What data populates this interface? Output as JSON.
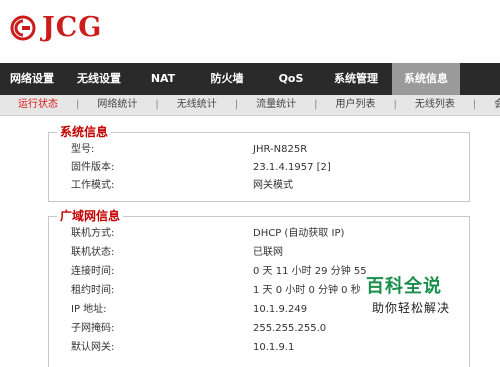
{
  "header": {
    "logo_text": "JCG"
  },
  "nav": {
    "items": [
      {
        "label": "网络设置"
      },
      {
        "label": "无线设置"
      },
      {
        "label": "NAT"
      },
      {
        "label": "防火墙"
      },
      {
        "label": "QoS"
      },
      {
        "label": "系统管理"
      },
      {
        "label": "系统信息"
      }
    ]
  },
  "subnav": {
    "items": [
      {
        "label": "运行状态"
      },
      {
        "label": "网络统计"
      },
      {
        "label": "无线统计"
      },
      {
        "label": "流量统计"
      },
      {
        "label": "用户列表"
      },
      {
        "label": "无线列表"
      },
      {
        "label": "会话"
      }
    ],
    "separator": "|"
  },
  "system_info": {
    "title": "系统信息",
    "rows": [
      {
        "label": "型号:",
        "value": "JHR-N825R"
      },
      {
        "label": "固件版本:",
        "value": "23.1.4.1957 [2]"
      },
      {
        "label": "工作模式:",
        "value": "网关模式"
      }
    ]
  },
  "wan_info": {
    "title": "广域网信息",
    "rows": [
      {
        "label": "联机方式:",
        "value": "DHCP (自动获取 IP)"
      },
      {
        "label": "联机状态:",
        "value": "已联网"
      },
      {
        "label": "连接时间:",
        "value": "0 天 11 小时 29 分钟 55"
      },
      {
        "label": "租约时间:",
        "value": "1 天 0 小时 0 分钟 0 秒"
      },
      {
        "label": "IP 地址:",
        "value": "10.1.9.249"
      },
      {
        "label": "子网掩码:",
        "value": "255.255.255.0"
      },
      {
        "label": "默认网关:",
        "value": "10.1.9.1"
      }
    ]
  },
  "watermark": {
    "title": "百科全说",
    "subtitle": "助你轻松解决"
  },
  "colors": {
    "brand_red": "#cc1d1d",
    "nav_bg": "#2a2a2a",
    "nav_active_bg": "#9a9a9a",
    "subnav_bg": "#e6e6e6",
    "subnav_active": "#d61b1b",
    "section_title": "#c40000",
    "watermark_green": "#1a8f4a"
  }
}
